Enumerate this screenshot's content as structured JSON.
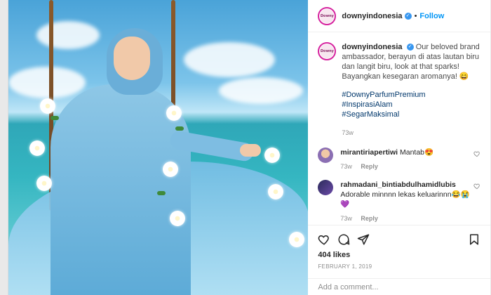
{
  "account": {
    "username": "downyindonesia",
    "verified": true,
    "follow_label": "Follow",
    "separator": "•",
    "avatar_text": "Downy"
  },
  "caption": {
    "username": "downyindonesia",
    "text": "Our beloved brand ambassador, berayun di atas lautan biru dan langit biru, look at that sparks! Bayangkan kesegaran aromanya! 😄",
    "hashtags": [
      "#DownyParfumPremium",
      "#InspirasiAlam",
      "#SegarMaksimal"
    ],
    "time": "73w"
  },
  "comments": [
    {
      "username": "mirantiriapertiwi",
      "text": "Mantab😍",
      "time": "73w",
      "reply_label": "Reply"
    },
    {
      "username": "rahmadani_bintiabdulhamidlubis",
      "text": "Adorable minnnn lekas keluarinnn😂😭💜",
      "time": "73w",
      "reply_label": "Reply"
    }
  ],
  "actions": {
    "icons": [
      "heart-icon",
      "comment-icon",
      "share-icon",
      "bookmark-icon"
    ],
    "likes": "404 likes",
    "date": "FEBRUARY 1, 2019"
  },
  "add_comment": {
    "placeholder": "Add a comment..."
  },
  "colors": {
    "accent": "#0095f6",
    "verified": "#3897f0",
    "hashtag": "#00376b"
  }
}
